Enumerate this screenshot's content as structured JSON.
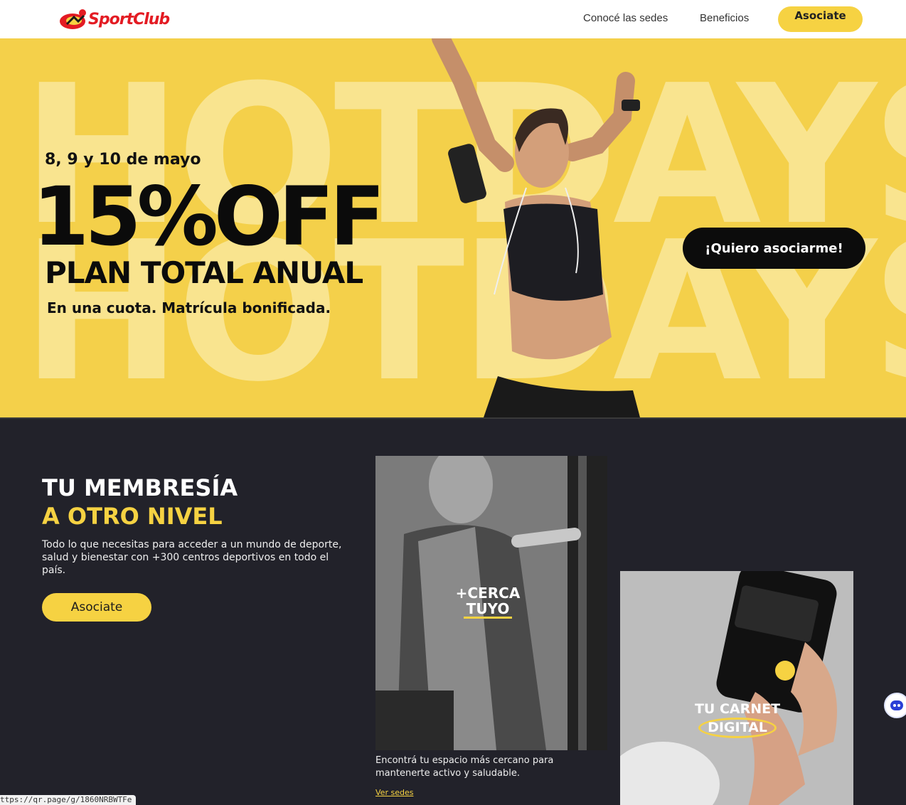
{
  "nav": {
    "logo_text": "SportClub",
    "links": [
      "Conocé las sedes",
      "Beneficios"
    ],
    "cta": "Asociate",
    "accent": "#f6d242",
    "brand_red": "#e31b23"
  },
  "hero": {
    "background_word": "HOTDAYS",
    "date": "8, 9 y 10 de mayo",
    "offer": "15%OFF",
    "plan": "PLAN TOTAL ANUAL",
    "subtitle": "En una cuota. Matrícula bonificada.",
    "cta": "¡Quiero asociarme!",
    "bg_color": "#f4d04a"
  },
  "membership": {
    "title_line1": "TU MEMBRESÍA",
    "title_line2": "A OTRO NIVEL",
    "description": "Todo lo que necesitas para acceder a un mundo de deporte, salud y bienestar con +300 centros deportivos en todo el país.",
    "cta": "Asociate"
  },
  "cards": [
    {
      "tag_line1": "+CERCA",
      "tag_line2": "TUYO",
      "caption": "Encontrá tu espacio más cercano para mantenerte activo y saludable.",
      "link": "Ver sedes"
    },
    {
      "tag_line1": "TU CARNET",
      "tag_line2": "DIGITAL"
    }
  ],
  "status_url": "ttps://qr.page/g/1860NRBWTFe"
}
